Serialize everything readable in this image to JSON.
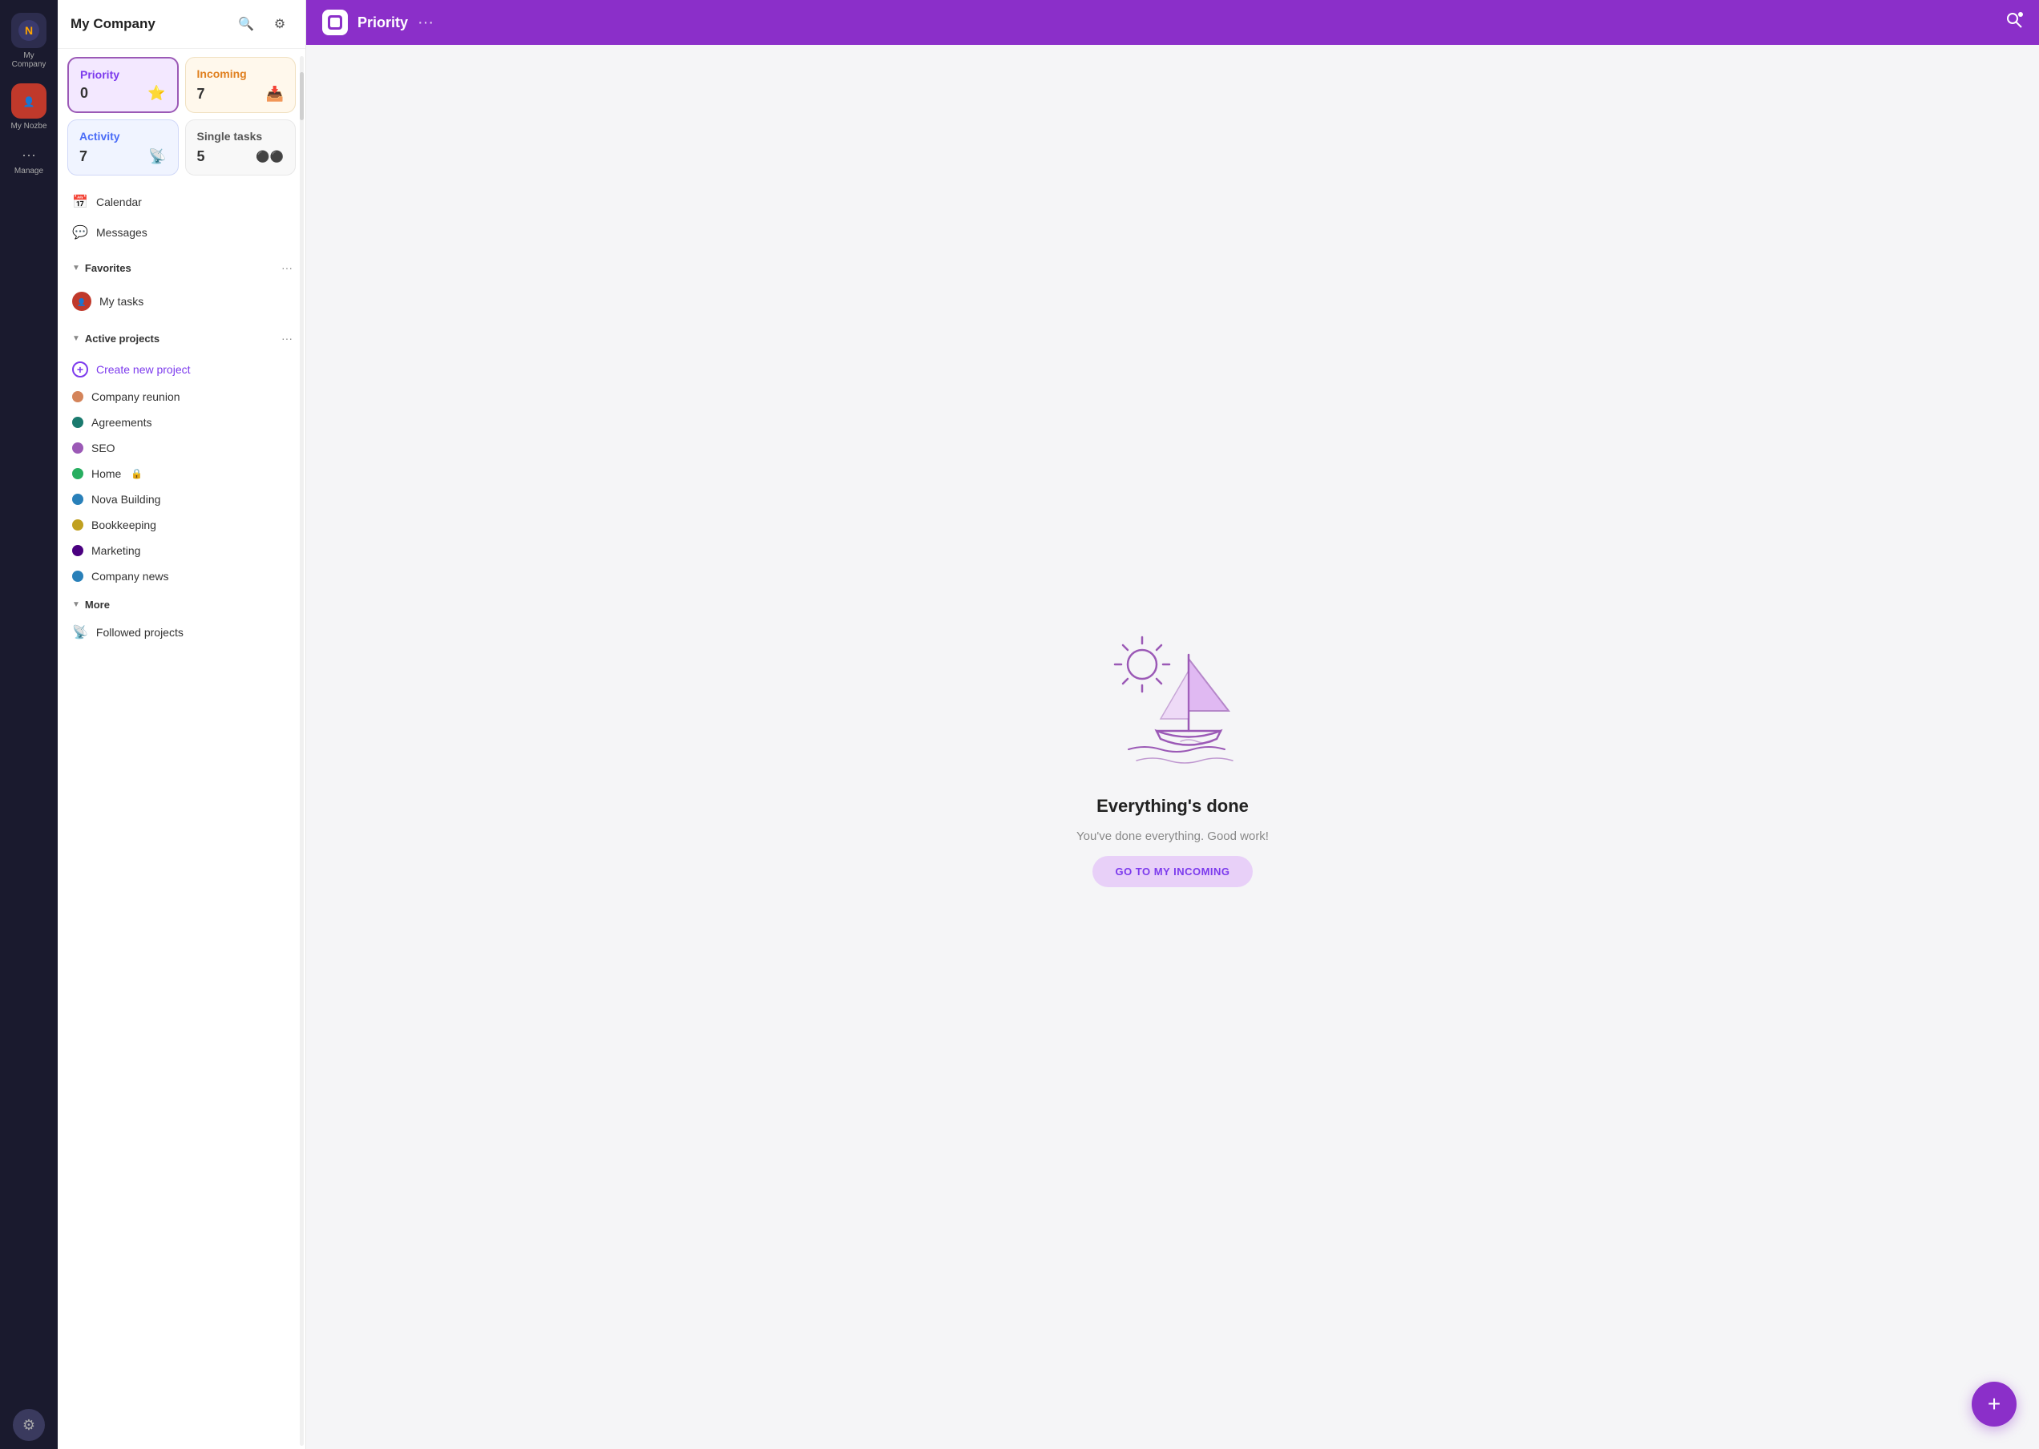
{
  "iconBar": {
    "companyLabel": "My Company",
    "myNozbeLabel": "My Nozbe",
    "manageLabel": "Manage"
  },
  "sidebar": {
    "title": "My Company",
    "searchLabel": "Search",
    "settingsLabel": "Settings",
    "tiles": [
      {
        "id": "priority",
        "label": "Priority",
        "count": "0",
        "icon": "⭐",
        "type": "priority"
      },
      {
        "id": "incoming",
        "label": "Incoming",
        "count": "7",
        "icon": "📥",
        "type": "incoming"
      },
      {
        "id": "activity",
        "label": "Activity",
        "count": "7",
        "icon": "📡",
        "type": "activity"
      },
      {
        "id": "single-tasks",
        "label": "Single tasks",
        "count": "5",
        "icon": "⚫⚫",
        "type": "single"
      }
    ],
    "navItems": [
      {
        "id": "calendar",
        "icon": "📅",
        "label": "Calendar"
      },
      {
        "id": "messages",
        "icon": "💬",
        "label": "Messages"
      }
    ],
    "favoritesSection": {
      "title": "Favorites",
      "items": [
        {
          "id": "my-tasks",
          "label": "My tasks"
        }
      ]
    },
    "activeProjectsSection": {
      "title": "Active projects",
      "items": [
        {
          "id": "create",
          "label": "Create new project",
          "color": null
        },
        {
          "id": "company-reunion",
          "label": "Company reunion",
          "color": "#d4845a"
        },
        {
          "id": "agreements",
          "label": "Agreements",
          "color": "#1a7a6e"
        },
        {
          "id": "seo",
          "label": "SEO",
          "color": "#9b59b6"
        },
        {
          "id": "home",
          "label": "Home",
          "color": "#27ae60",
          "locked": true
        },
        {
          "id": "nova-building",
          "label": "Nova Building",
          "color": "#2980b9"
        },
        {
          "id": "bookkeeping",
          "label": "Bookkeeping",
          "color": "#c0a020"
        },
        {
          "id": "marketing",
          "label": "Marketing",
          "color": "#4a0080"
        },
        {
          "id": "company-news",
          "label": "Company news",
          "color": "#2980b9"
        }
      ]
    },
    "moreSection": {
      "title": "More",
      "items": [
        {
          "id": "followed-projects",
          "label": "Followed projects"
        }
      ]
    }
  },
  "topbar": {
    "title": "Priority",
    "searchLabel": "Search"
  },
  "emptyState": {
    "title": "Everything's done",
    "subtitle": "You've done everything. Good work!",
    "buttonLabel": "GO TO MY INCOMING"
  },
  "fab": {
    "label": "+"
  }
}
